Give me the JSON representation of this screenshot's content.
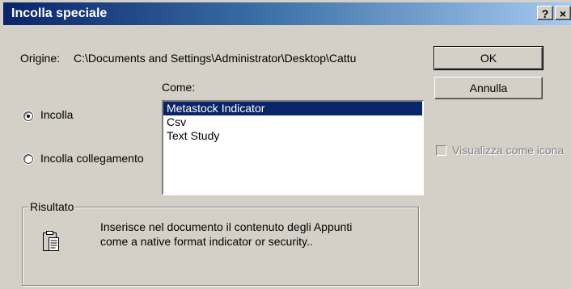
{
  "window": {
    "title": "Incolla speciale",
    "help_glyph": "?",
    "close_glyph": "×"
  },
  "source": {
    "label": "Origine:",
    "path": "C:\\Documents and Settings\\Administrator\\Desktop\\Cattu"
  },
  "as": {
    "label": "Come:"
  },
  "options": {
    "paste_label": "Incolla",
    "paste_selected": true,
    "paste_link_label": "Incolla collegamento",
    "paste_link_selected": false
  },
  "formats": {
    "items": [
      {
        "label": "Metastock Indicator",
        "selected": true
      },
      {
        "label": "Csv",
        "selected": false
      },
      {
        "label": "Text Study",
        "selected": false
      }
    ]
  },
  "buttons": {
    "ok_label": "OK",
    "cancel_label": "Annulla"
  },
  "display_as_icon": {
    "label": "Visualizza come icona",
    "checked": false,
    "enabled": false
  },
  "result": {
    "group_label": "Risultato",
    "line1": "Inserisce nel documento il contenuto degli Appunti",
    "line2": "come a native format indicator or security..",
    "icon": "clipboard-icon"
  },
  "colors": {
    "dialog_face": "#d4d0c8",
    "title_gradient_start": "#0a246a",
    "title_gradient_end": "#a6caf0",
    "selection": "#0a246a"
  }
}
